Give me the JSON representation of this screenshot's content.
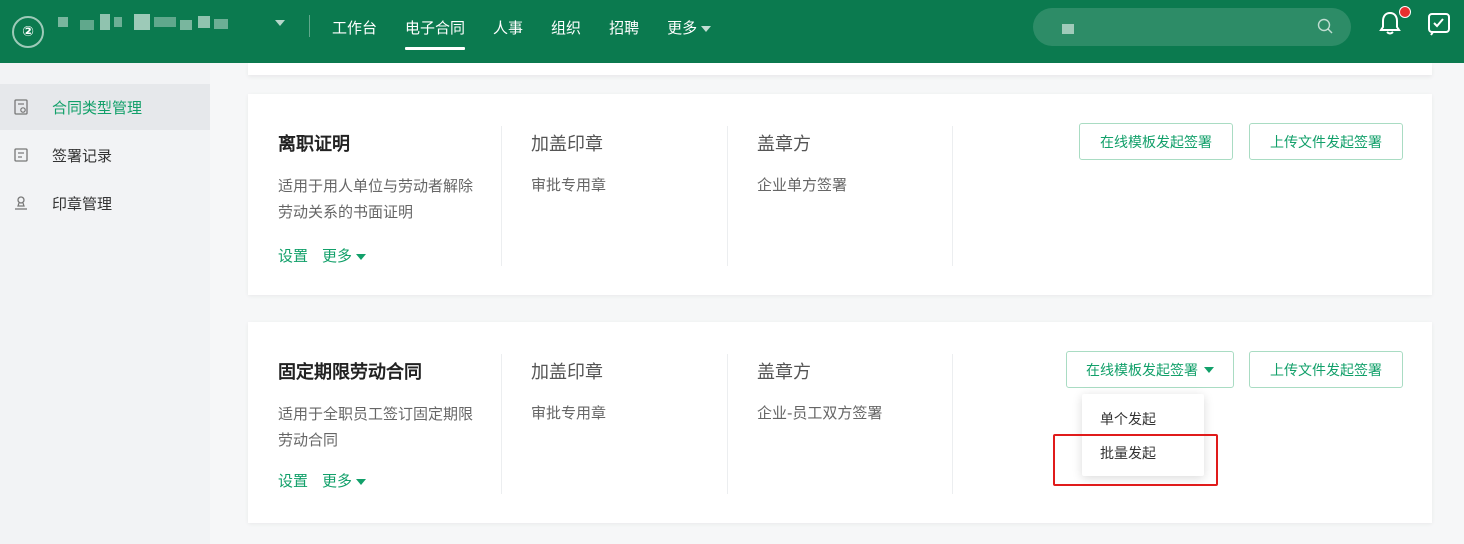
{
  "topbar": {
    "logo_text": "②",
    "nav": [
      {
        "label": "工作台"
      },
      {
        "label": "电子合同",
        "active": true
      },
      {
        "label": "人事"
      },
      {
        "label": "组织"
      },
      {
        "label": "招聘"
      },
      {
        "label": "更多"
      }
    ],
    "icons": [
      "search-icon",
      "bell-icon",
      "todo-icon"
    ],
    "colors": {
      "bar": "#0b7a4f",
      "accent": "#12a06a",
      "badge": "#e8302f"
    }
  },
  "sidebar": {
    "items": [
      {
        "label": "合同类型管理",
        "icon": "contract-icon",
        "active": true
      },
      {
        "label": "签署记录",
        "icon": "record-icon"
      },
      {
        "label": "印章管理",
        "icon": "seal-icon"
      }
    ]
  },
  "cards": [
    {
      "title": "离职证明",
      "desc": "适用于用人单位与劳动者解除劳动关系的书面证明",
      "settings": "设置",
      "more": "更多",
      "seal_head": "加盖印章",
      "seal_val": "审批专用章",
      "signer_head": "盖章方",
      "signer_val": "企业单方签署",
      "btn_online": "在线模板发起签署",
      "btn_upload": "上传文件发起签署"
    },
    {
      "title": "固定期限劳动合同",
      "desc": "适用于全职员工签订固定期限劳动合同",
      "settings": "设置",
      "more": "更多",
      "seal_head": "加盖印章",
      "seal_val": "审批专用章",
      "signer_head": "盖章方",
      "signer_val": "企业-员工双方签署",
      "btn_online": "在线模板发起签署",
      "btn_upload": "上传文件发起签署"
    }
  ],
  "dropdown": {
    "items": [
      {
        "label": "单个发起"
      },
      {
        "label": "批量发起"
      }
    ]
  }
}
